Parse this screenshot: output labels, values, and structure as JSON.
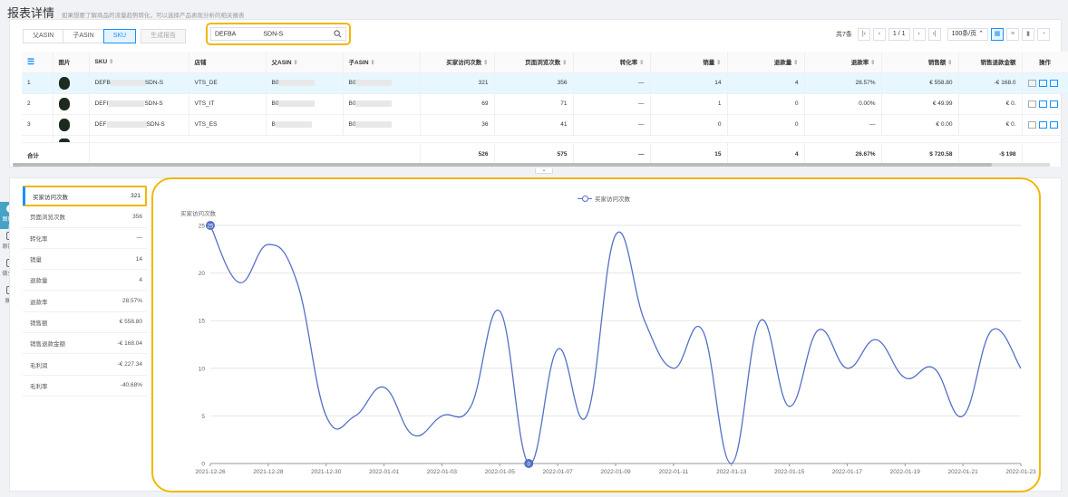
{
  "header": {
    "title": "报表详情",
    "subtitle": "如果想要了解商品的流量趋势转化，可以选择产品表现分析的相关报表"
  },
  "toolbar": {
    "tabs": [
      "父ASIN",
      "子ASIN",
      "SKU"
    ],
    "generate_report": "生成报告",
    "search_value_prefix": "DEFBA",
    "search_value_suffix": "SDN-S",
    "total_label": "共7条",
    "page_current": "1",
    "page_total": "/ 1",
    "page_size": "100条/页"
  },
  "table": {
    "headers": {
      "idx": "",
      "img": "图片",
      "sku": "SKU",
      "store": "店铺",
      "parent_asin": "父ASIN",
      "child_asin": "子ASIN",
      "visits": "买家访问次数",
      "page_views": "页面浏览次数",
      "conversion": "转化率",
      "sales": "销量",
      "refunds": "退款量",
      "refund_rate": "退款率",
      "revenue": "销售额",
      "refund_amount": "销售退款金额",
      "ops": "操作"
    },
    "rows": [
      {
        "idx": "1",
        "sku_a": "DEFB",
        "sku_b": "SDN-S",
        "store": "VTS_DE",
        "parent": "B0",
        "child": "B0",
        "visits": "321",
        "page_views": "356",
        "conversion": "—",
        "sales": "14",
        "refunds": "4",
        "refund_rate": "28.57%",
        "revenue": "€ 558.80",
        "refund_amount": "-€ 168.0"
      },
      {
        "idx": "2",
        "sku_a": "DEFI",
        "sku_b": "SDN-S",
        "store": "VTS_IT",
        "parent": "B0",
        "child": "B0",
        "visits": "69",
        "page_views": "71",
        "conversion": "—",
        "sales": "1",
        "refunds": "0",
        "refund_rate": "0.00%",
        "revenue": "€ 49.99",
        "refund_amount": "€ 0."
      },
      {
        "idx": "3",
        "sku_a": "DEF",
        "sku_b": "SDN-S",
        "store": "VTS_ES",
        "parent": "B",
        "child": "B0",
        "visits": "36",
        "page_views": "41",
        "conversion": "—",
        "sales": "0",
        "refunds": "0",
        "refund_rate": "—",
        "revenue": "€ 0.00",
        "refund_amount": "€ 0."
      }
    ],
    "total": {
      "label": "合计",
      "visits": "526",
      "page_views": "575",
      "conversion": "—",
      "sales": "15",
      "refunds": "4",
      "refund_rate": "26.67%",
      "revenue": "$ 720.58",
      "refund_amount": "-$ 198"
    }
  },
  "sidetools": [
    {
      "label": "图形展示",
      "icon": "pie-chart-icon"
    },
    {
      "label": "原数据",
      "icon": "table-icon"
    },
    {
      "label": "做分析",
      "icon": "analysis-icon"
    },
    {
      "label": "展开",
      "icon": "expand-icon"
    }
  ],
  "metrics": [
    {
      "label": "买家访问次数",
      "value": "321"
    },
    {
      "label": "页面浏览次数",
      "value": "356"
    },
    {
      "label": "转化率",
      "value": "—"
    },
    {
      "label": "销量",
      "value": "14"
    },
    {
      "label": "退款量",
      "value": "4"
    },
    {
      "label": "退款率",
      "value": "28.57%"
    },
    {
      "label": "销售额",
      "value": "€ 558.80"
    },
    {
      "label": "销售退款金额",
      "value": "-€ 168.04"
    },
    {
      "label": "毛利润",
      "value": "-€ 227.34"
    },
    {
      "label": "毛利率",
      "value": "-40.68%"
    }
  ],
  "chart_data": {
    "type": "line",
    "legend": "买家访问次数",
    "ylabel": "买家访问次数",
    "ylim": [
      0,
      25
    ],
    "yticks": [
      0,
      5,
      10,
      15,
      20,
      25
    ],
    "xtick_labels": [
      "2021-12-26",
      "2021-12-28",
      "2021-12-30",
      "2022-01-01",
      "2022-01-03",
      "2022-01-05",
      "2022-01-07",
      "2022-01-09",
      "2022-01-11",
      "2022-01-13",
      "2022-01-15",
      "2022-01-17",
      "2022-01-19",
      "2022-01-21",
      "2022-01-23"
    ],
    "x": [
      "2021-12-26",
      "2021-12-27",
      "2021-12-28",
      "2021-12-29",
      "2021-12-30",
      "2021-12-31",
      "2022-01-01",
      "2022-01-02",
      "2022-01-03",
      "2022-01-04",
      "2022-01-05",
      "2022-01-06",
      "2022-01-07",
      "2022-01-08",
      "2022-01-09",
      "2022-01-10",
      "2022-01-11",
      "2022-01-12",
      "2022-01-13",
      "2022-01-14",
      "2022-01-15",
      "2022-01-16",
      "2022-01-17",
      "2022-01-18",
      "2022-01-19",
      "2022-01-20",
      "2022-01-21",
      "2022-01-22",
      "2022-01-23"
    ],
    "series": [
      {
        "name": "买家访问次数",
        "values": [
          25,
          19,
          23,
          19,
          5,
          5,
          8,
          3,
          5,
          6,
          16,
          0,
          12,
          5,
          24,
          15,
          10,
          14,
          0,
          15,
          6,
          14,
          10,
          13,
          9,
          10,
          5,
          14,
          10
        ]
      }
    ],
    "marked_points": [
      {
        "x": "2021-12-26",
        "y": 25
      },
      {
        "x": "2022-01-06",
        "y": 0
      }
    ],
    "line_color": "#5470c6",
    "grid": true
  },
  "colors": {
    "accent": "#1890ff",
    "highlight_frame": "#f2b705",
    "line": "#5470c6",
    "side_active": "#45a3c5"
  }
}
